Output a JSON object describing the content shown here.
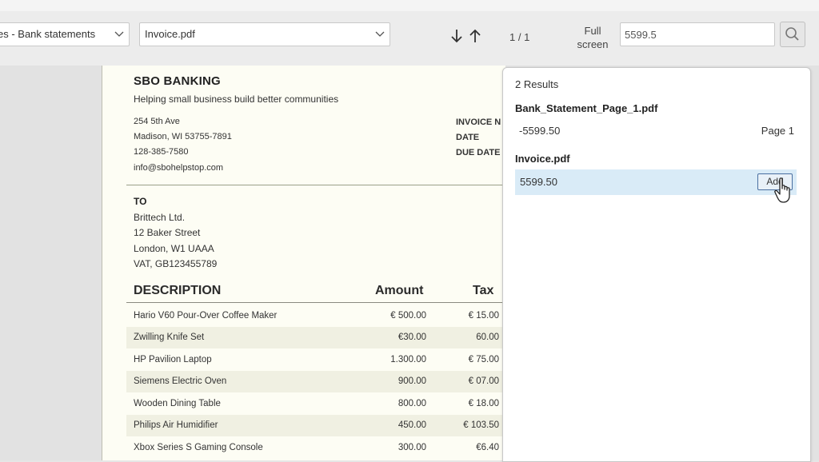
{
  "toolbar": {
    "document_set": "es - Bank statements",
    "file": "Invoice.pdf",
    "page_indicator": "1 / 1",
    "fullscreen_line1": "Full",
    "fullscreen_line2": "screen",
    "search_value": "5599.5"
  },
  "invoice": {
    "company": "SBO BANKING",
    "tagline": "Helping small business build better communities",
    "address": [
      "254 5th Ave",
      "Madison, WI 53755-7891",
      "128-385-7580",
      "info@sbohelpstop.com"
    ],
    "meta_labels": [
      "INVOICE N",
      "DATE",
      "DUE DATE"
    ],
    "to_label": "TO",
    "to_lines": [
      "Brittech Ltd.",
      "12 Baker Street",
      "London, W1 UAAA",
      "VAT, GB123455789"
    ],
    "headers": {
      "description": "DESCRIPTION",
      "amount": "Amount",
      "tax": "Tax"
    },
    "rows": [
      {
        "description": "Hario V60 Pour-Over Coffee Maker",
        "amount": "€ 500.00",
        "tax": "€ 15.00"
      },
      {
        "description": "Zwilling Knife Set",
        "amount": "€30.00",
        "tax": "60.00"
      },
      {
        "description": "HP Pavilion Laptop",
        "amount": "1.300.00",
        "tax": "€ 75.00"
      },
      {
        "description": "Siemens Electric Oven",
        "amount": "900.00",
        "tax": "€ 07.00"
      },
      {
        "description": "Wooden Dining Table",
        "amount": "800.00",
        "tax": "€ 18.00"
      },
      {
        "description": "Philips Air Humidifier",
        "amount": "450.00",
        "tax": "€ 103.50"
      },
      {
        "description": "Xbox Series S Gaming Console",
        "amount": "300.00",
        "tax": "€6.40"
      }
    ]
  },
  "results": {
    "count": "2 Results",
    "groups": [
      {
        "file": "Bank_Statement_Page_1.pdf",
        "value": "-5599.50",
        "page": "Page 1"
      },
      {
        "file": "Invoice.pdf",
        "value": "5599.50",
        "action": "Add"
      }
    ]
  },
  "colors": {
    "highlight": "#d9ebf7",
    "page_background": "#fdfdf4"
  }
}
